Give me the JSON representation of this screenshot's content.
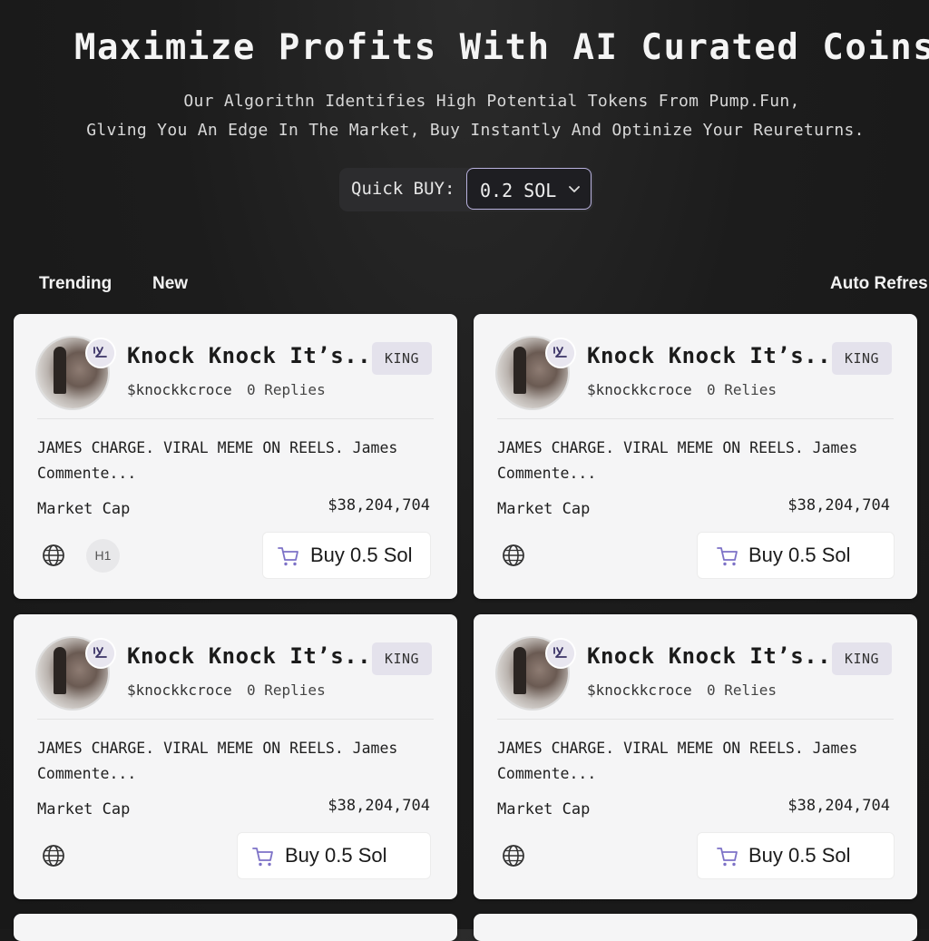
{
  "hero": {
    "title": "Maximize Profits With AI Curated Coins",
    "subtitle_line1": "Our Algorithn Identifies High Potential Tokens From Pump.Fun,",
    "subtitle_line2": "Glving You An Edge In The Market, Buy Instantly And Optinize Your Reureturns."
  },
  "quick_buy": {
    "label": "Quick BUY:",
    "selected": "0.2 SOL",
    "icon": "chevron-down-icon"
  },
  "tabs": {
    "trending": "Trending",
    "new": "New",
    "auto_refresh": "Auto Refres"
  },
  "cards": [
    {
      "name": "Knock Knock It’s...",
      "ticker": "$knockkcroce",
      "replies": "0 Replies",
      "badge": "KING",
      "description": "JAMES CHARGE. VIRAL MEME ON REELS. James Commente...",
      "market_cap_label": "Market Cap",
      "market_cap": "$38,204,704",
      "extra_icon_label": "H1",
      "buy_label": "Buy 0.5 Sol"
    },
    {
      "name": "Knock Knock It’s...",
      "ticker": "$knockkcroce",
      "replies": "0 Relies",
      "badge": "KING",
      "description": "JAMES CHARGE. VIRAL MEME ON REELS. James Commente...",
      "market_cap_label": "Market Cap",
      "market_cap": "$38,204,704",
      "buy_label": "Buy 0.5 Sol"
    },
    {
      "name": "Knock Knock It’s...",
      "ticker": "$knockkcroce",
      "replies": "0 Replies",
      "badge": "KING",
      "description": "JAMES CHARGE. VIRAL MEME ON REELS. James Commente...",
      "market_cap_label": "Market Cap",
      "market_cap": "$38,204,704",
      "buy_label": "Buy 0.5 Sol"
    },
    {
      "name": "Knock Knock It’s...",
      "ticker": "$knockkcroce",
      "replies": "0 Relies",
      "badge": "KING",
      "description": "JAMES CHARGE. VIRAL MEME ON REELS. James Commente...",
      "market_cap_label": "Market Cap",
      "market_cap": "$38,204,704",
      "buy_label": "Buy 0.5 Sol"
    }
  ],
  "colors": {
    "background": "#1c1c1c",
    "card": "#f5f5f6",
    "badge_bg": "#e4e2ec",
    "select_border": "#b9b2de",
    "cart_accent": "#7d72c7"
  }
}
